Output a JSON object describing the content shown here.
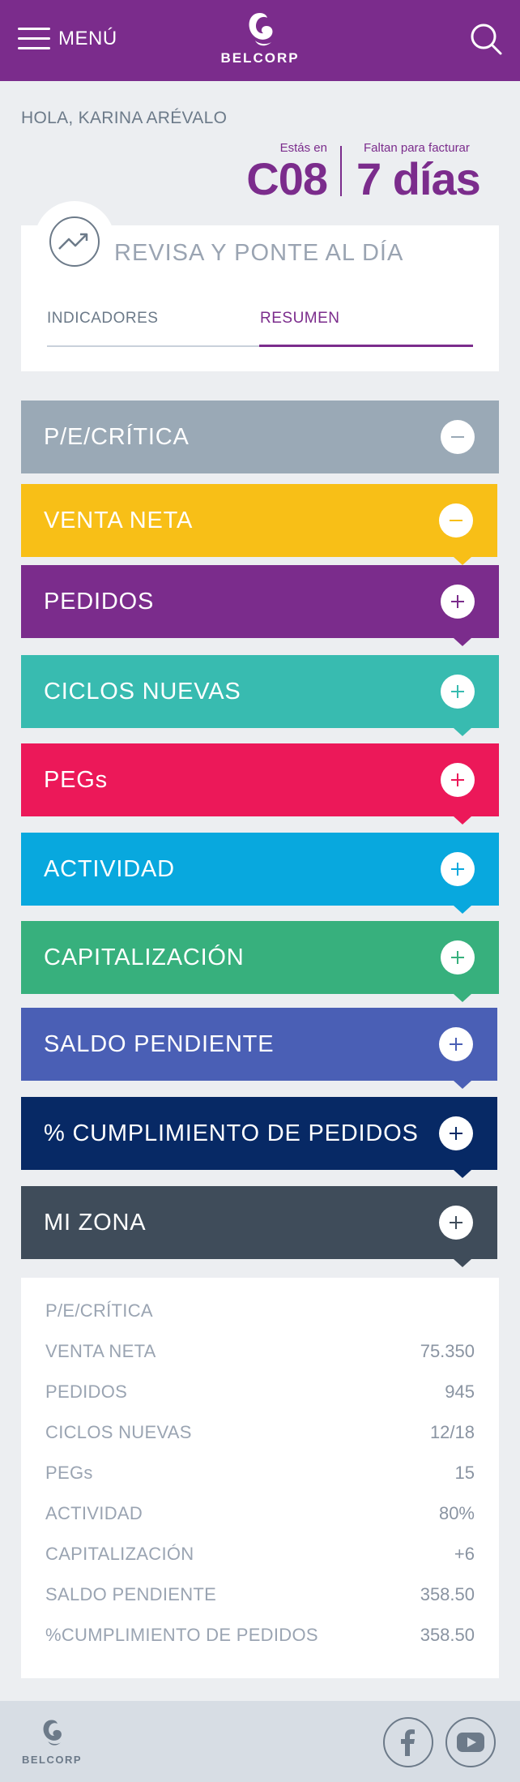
{
  "header": {
    "menu_label": "MENÚ",
    "logo_text": "BELCORP",
    "brand_color": "#7b2c8c"
  },
  "greeting": "HOLA, KARINA ARÉVALO",
  "campaign": {
    "label": "Estás en",
    "value": "C08"
  },
  "billing": {
    "label": "Faltan para facturar",
    "value": "7 días"
  },
  "review": {
    "title": "REVISA Y PONTE AL DÍA",
    "tabs": [
      {
        "label": "INDICADORES",
        "active": false
      },
      {
        "label": "RESUMEN",
        "active": true
      }
    ]
  },
  "accordion": [
    {
      "label": "P/E/CRÍTICA",
      "color": "#9aa9b6",
      "state": "minus",
      "icon": "minus-icon"
    },
    {
      "label": "VENTA NETA",
      "color": "#f8bf17",
      "state": "minus",
      "icon": "minus-icon"
    },
    {
      "label": "PEDIDOS",
      "color": "#7b2c8c",
      "state": "plus",
      "icon": "plus-icon"
    },
    {
      "label": "CICLOS NUEVAS",
      "color": "#38bbb0",
      "state": "plus",
      "icon": "plus-icon"
    },
    {
      "label": "PEGs",
      "color": "#ec1859",
      "state": "plus",
      "icon": "plus-icon"
    },
    {
      "label": "ACTIVIDAD",
      "color": "#08a8de",
      "state": "plus",
      "icon": "plus-icon"
    },
    {
      "label": "CAPITALIZACIÓN",
      "color": "#37b07d",
      "state": "plus",
      "icon": "plus-icon"
    },
    {
      "label": "SALDO PENDIENTE",
      "color": "#4a5fb5",
      "state": "plus",
      "icon": "plus-icon"
    },
    {
      "label": "% CUMPLIMIENTO DE PEDIDOS",
      "color": "#072965",
      "state": "plus",
      "icon": "plus-icon"
    },
    {
      "label": "MI ZONA",
      "color": "#3f4c5a",
      "state": "plus",
      "icon": "plus-icon"
    }
  ],
  "summary": [
    {
      "label": "P/E/CRÍTICA",
      "value": ""
    },
    {
      "label": "VENTA NETA",
      "value": "75.350"
    },
    {
      "label": "PEDIDOS",
      "value": "945"
    },
    {
      "label": "CICLOS NUEVAS",
      "value": "12/18"
    },
    {
      "label": "PEGs",
      "value": "15"
    },
    {
      "label": "ACTIVIDAD",
      "value": "80%"
    },
    {
      "label": "CAPITALIZACIÓN",
      "value": "+6"
    },
    {
      "label": "SALDO PENDIENTE",
      "value": "358.50"
    },
    {
      "label": "%CUMPLIMIENTO DE PEDIDOS",
      "value": "358.50"
    }
  ],
  "footer": {
    "logo_text": "BELCORP",
    "social": [
      {
        "icon": "facebook-icon"
      },
      {
        "icon": "youtube-icon"
      }
    ]
  }
}
